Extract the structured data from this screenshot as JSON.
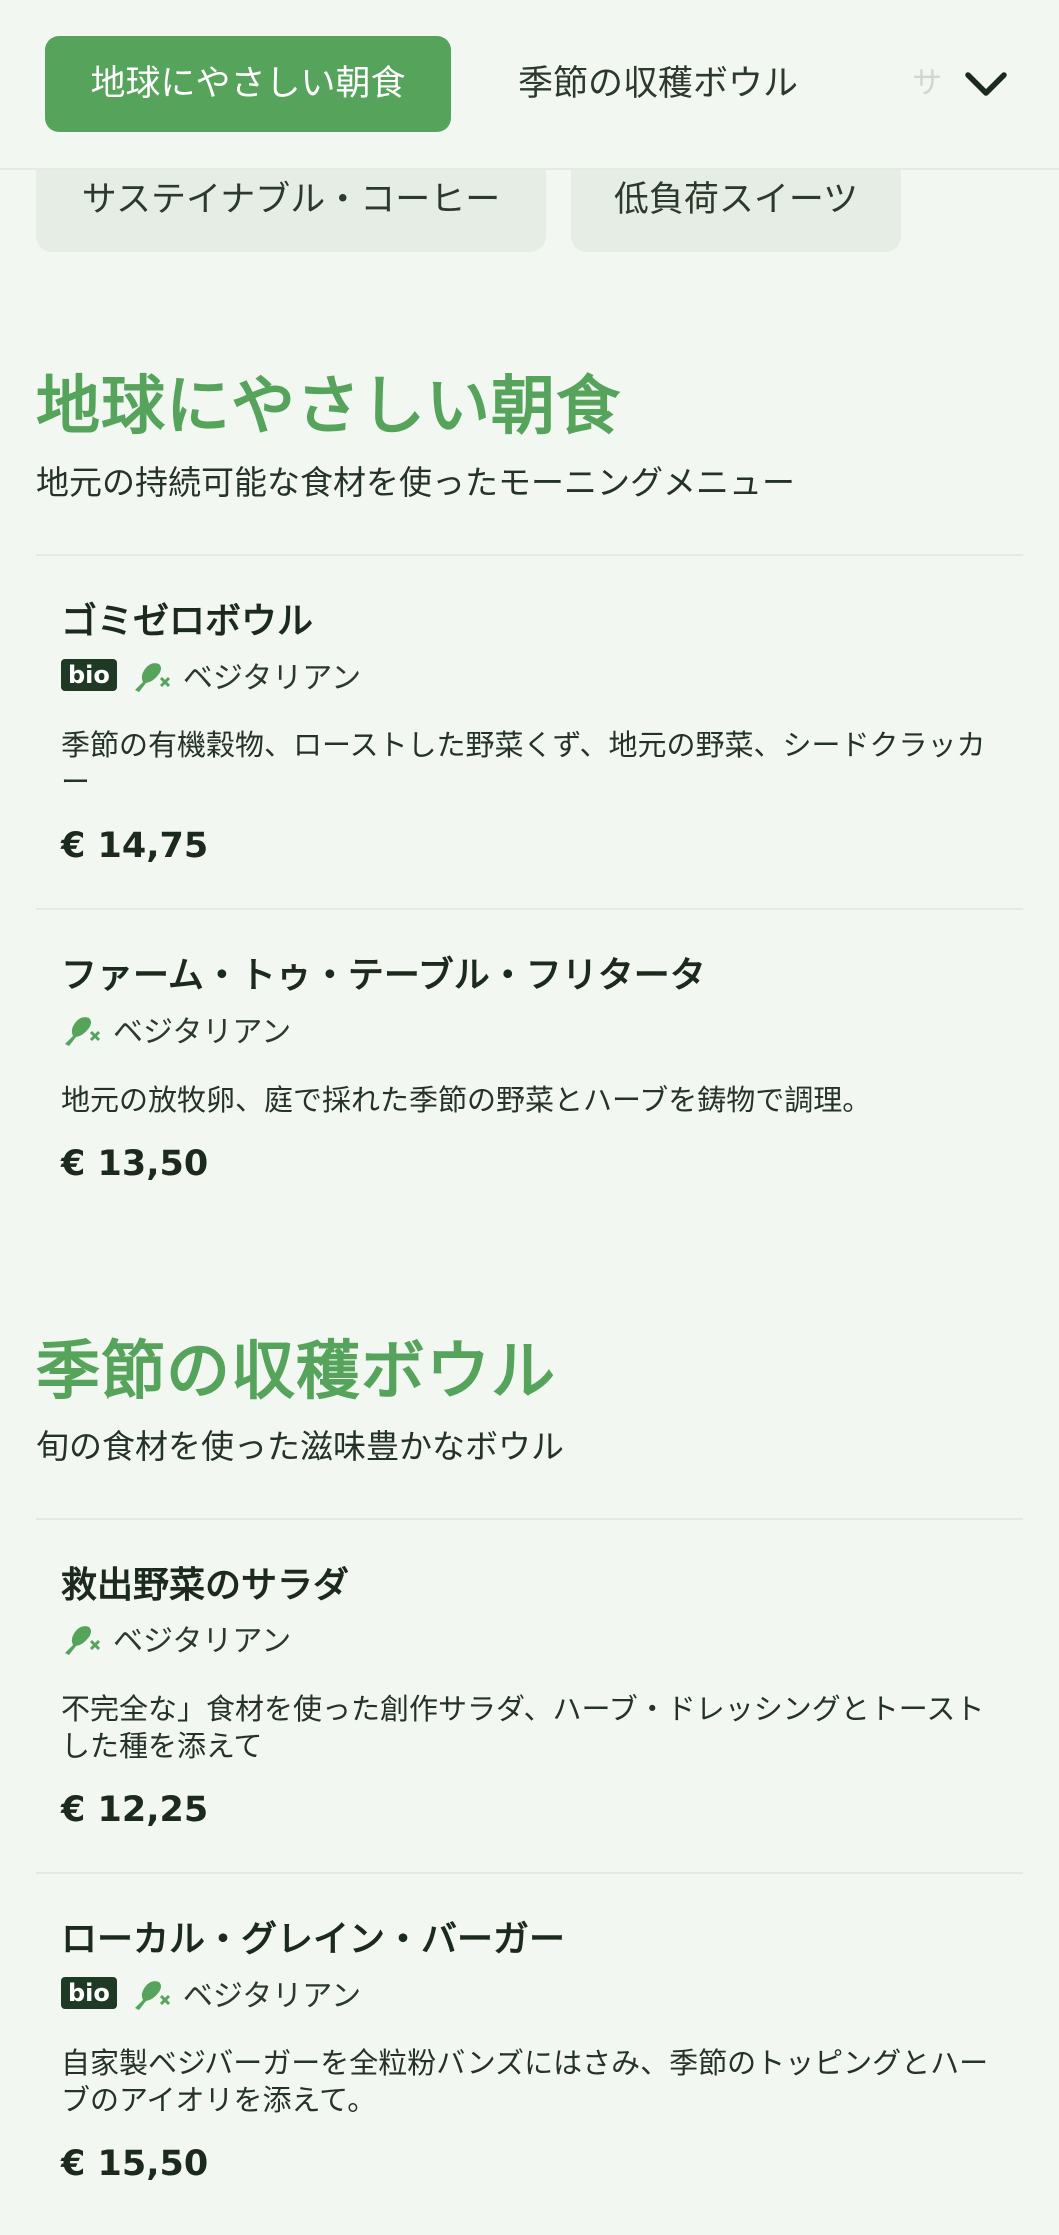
{
  "nav": {
    "tabs": [
      {
        "label": "地球にやさしい朝食",
        "active": true
      },
      {
        "label": "季節の収穫ボウル",
        "active": false
      },
      {
        "label": "サ",
        "active": false
      }
    ],
    "expand_icon": "chevron-down-icon",
    "chips": [
      {
        "label": "サステイナブル・コーヒー"
      },
      {
        "label": "低負荷スイーツ"
      }
    ]
  },
  "sections": [
    {
      "title": "地球にやさしい朝食",
      "subtitle": "地元の持続可能な食材を使ったモーニングメニュー",
      "items": [
        {
          "name": "ゴミゼロボウル",
          "bio": "bio",
          "diet": "ベジタリアン",
          "description": "季節の有機穀物、ローストした野菜くず、地元の野菜、シードクラッカー",
          "price": "€ 14,75"
        },
        {
          "name": "ファーム・トゥ・テーブル・フリタータ",
          "diet": "ベジタリアン",
          "description": "地元の放牧卵、庭で採れた季節の野菜とハーブを鋳物で調理。",
          "price": "€ 13,50"
        }
      ]
    },
    {
      "title": "季節の収穫ボウル",
      "subtitle": "旬の食材を使った滋味豊かなボウル",
      "items": [
        {
          "name": "救出野菜のサラダ",
          "diet": "ベジタリアン",
          "description": "不完全な」食材を使った創作サラダ、ハーブ・ドレッシングとトーストした種を添えて",
          "price": "€ 12,25"
        },
        {
          "name": "ローカル・グレイン・バーガー",
          "bio": "bio",
          "diet": "ベジタリアン",
          "description": "自家製ベジバーガーを全粒粉バンズにはさみ、季節のトッピングとハーブのアイオリを添えて。",
          "price": "€ 15,50"
        }
      ]
    }
  ],
  "colors": {
    "accent": "#56a35b",
    "background": "#f2f7f1",
    "bio_badge": "#1f3a24",
    "chip": "#e6ede4"
  }
}
